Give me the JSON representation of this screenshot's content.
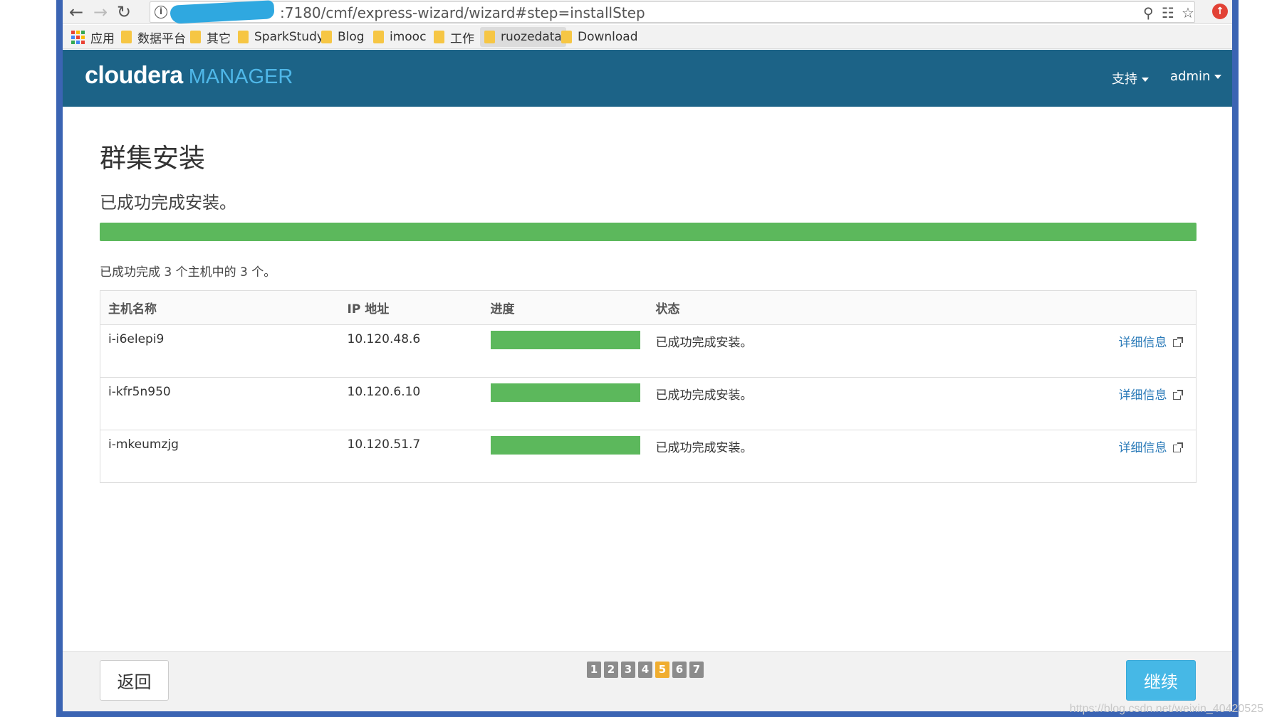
{
  "browser": {
    "url_visible": ":7180/cmf/express-wizard/wizard#step=installStep",
    "bookmarks": [
      {
        "label": "应用",
        "type": "apps"
      },
      {
        "label": "数据平台",
        "type": "folder"
      },
      {
        "label": "其它",
        "type": "folder"
      },
      {
        "label": "SparkStudy",
        "type": "folder"
      },
      {
        "label": "Blog",
        "type": "folder"
      },
      {
        "label": "imooc",
        "type": "folder"
      },
      {
        "label": "工作",
        "type": "folder"
      },
      {
        "label": "ruozedata",
        "type": "folder",
        "active": true
      },
      {
        "label": "Download",
        "type": "folder"
      }
    ]
  },
  "header": {
    "logo_main": "cloudera",
    "logo_sub": "MANAGER",
    "menu_support": "支持",
    "menu_user": "admin",
    "bg_color": "#1c6387"
  },
  "page": {
    "title": "群集安装",
    "status": "已成功完成安装。",
    "overall_progress": 1.0,
    "summary": "已成功完成 3 个主机中的 3 个。"
  },
  "table": {
    "headers": [
      "主机名称",
      "IP 地址",
      "进度",
      "状态",
      ""
    ],
    "rows": [
      {
        "host": "i-i6elepi9",
        "ip": "10.120.48.6",
        "progress": 1.0,
        "status": "已成功完成安装。",
        "link": "详细信息"
      },
      {
        "host": "i-kfr5n950",
        "ip": "10.120.6.10",
        "progress": 1.0,
        "status": "已成功完成安装。",
        "link": "详细信息"
      },
      {
        "host": "i-mkeumzjg",
        "ip": "10.120.51.7",
        "progress": 1.0,
        "status": "已成功完成安装。",
        "link": "详细信息"
      }
    ]
  },
  "footer": {
    "back_label": "返回",
    "continue_label": "继续",
    "steps": [
      "1",
      "2",
      "3",
      "4",
      "5",
      "6",
      "7"
    ],
    "current_step": "5"
  },
  "watermark": "https://blog.csdn.net/weixin_40420525",
  "colors": {
    "progress": "#5cb85c",
    "continue_button": "#46b8e6",
    "current_step": "#f0ad2f",
    "link": "#2a7ab8"
  }
}
